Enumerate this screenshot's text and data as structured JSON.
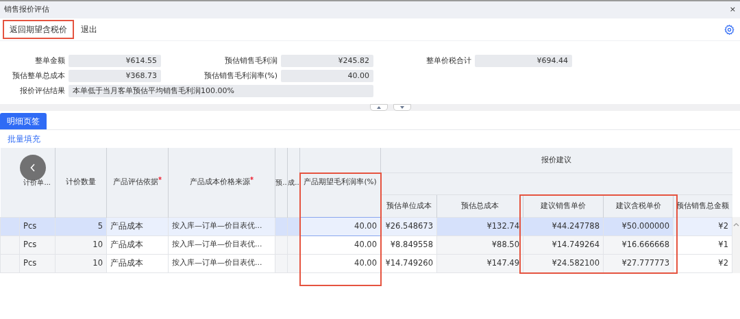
{
  "window": {
    "title": "销售报价评估",
    "close": "×"
  },
  "toolbar": {
    "buttons": [
      {
        "label": "返回期望含税价",
        "highlighted": true
      },
      {
        "label": "退出",
        "highlighted": false
      }
    ]
  },
  "summary": {
    "fields": [
      {
        "label": "整单金额",
        "value": "¥614.55",
        "kind": "amount"
      },
      {
        "label": "预估销售毛利润",
        "value": "¥245.82",
        "kind": "amount"
      },
      {
        "label": "整单价税合计",
        "value": "¥694.44",
        "kind": "amount"
      },
      {
        "label": "预估整单总成本",
        "value": "¥368.73",
        "kind": "amount"
      },
      {
        "label": "预估销售毛利润率(%)",
        "value": "40.00",
        "kind": "amount"
      },
      {
        "label": "报价评估结果",
        "value": "本单低于当月客单预估平均销售毛利润100.00%",
        "kind": "text"
      }
    ]
  },
  "tabs": [
    {
      "label": "明细页签",
      "selected": true
    }
  ],
  "batch_fill": "批量填充",
  "table": {
    "group_header": "报价建议",
    "columns": [
      {
        "label": "计价单...",
        "readonly": true,
        "group": false
      },
      {
        "label": "计价数量",
        "readonly": true,
        "group": false
      },
      {
        "label": "产品评估依据",
        "readonly": false,
        "group": false,
        "required": true
      },
      {
        "label": "产品成本价格来源",
        "readonly": false,
        "group": false,
        "required": true
      },
      {
        "label": "预..",
        "readonly": true,
        "group": false
      },
      {
        "label": "成..",
        "readonly": true,
        "group": false
      },
      {
        "label": "产品期望毛利润率(%)",
        "readonly": false,
        "group": false,
        "editable": true,
        "highlighted": true
      },
      {
        "label": "预估单位成本",
        "readonly": false,
        "group": true
      },
      {
        "label": "预估总成本",
        "readonly": true,
        "group": true
      },
      {
        "label": "建议销售单价",
        "readonly": true,
        "group": true,
        "highlighted": true
      },
      {
        "label": "建议含税单价",
        "readonly": true,
        "group": true,
        "highlighted": true
      },
      {
        "label": "预估销售总金额",
        "readonly": false,
        "group": true
      }
    ],
    "rows": [
      {
        "selected": true,
        "cells": [
          "Pcs",
          "5",
          "产品成本",
          "按入库—订单—价目表优...",
          "",
          "",
          "40.00",
          "¥26.548673",
          "¥132.74",
          "¥44.247788",
          "¥50.000000",
          "¥2"
        ]
      },
      {
        "selected": false,
        "cells": [
          "Pcs",
          "10",
          "产品成本",
          "按入库—订单—价目表优...",
          "",
          "",
          "40.00",
          "¥8.849558",
          "¥88.50",
          "¥14.749264",
          "¥16.666668",
          "¥1"
        ]
      },
      {
        "selected": false,
        "cells": [
          "Pcs",
          "10",
          "产品成本",
          "按入库—订单—价目表优...",
          "",
          "",
          "40.00",
          "¥14.749260",
          "¥147.49",
          "¥24.582100",
          "¥27.777773",
          "¥2"
        ]
      }
    ]
  }
}
